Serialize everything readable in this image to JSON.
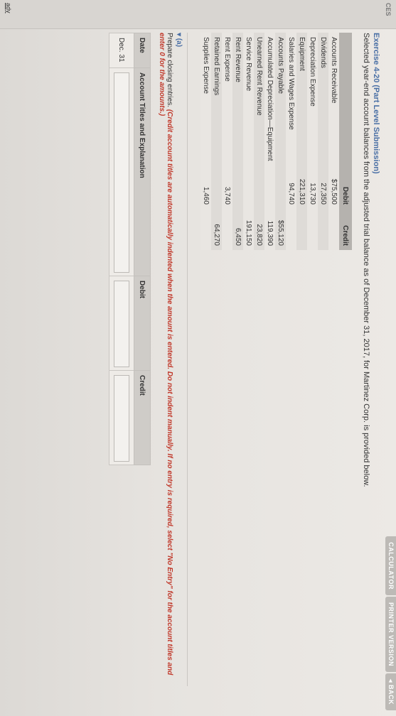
{
  "sidebar": {
    "label_top": "CES",
    "label_bottom": "ady"
  },
  "toolbar": {
    "calculator": "CALCULATOR",
    "printer_version": "PRINTER VERSION",
    "back": "◂ BACK"
  },
  "exercise": {
    "title": "Exercise 4-20 (Part Level Submission)",
    "intro": "Selected year-end account balances from the adjusted trial balance as of December 31, 2017, for Martinez Corp. is provided below."
  },
  "trial_balance": {
    "headers": {
      "debit": "Debit",
      "credit": "Credit"
    },
    "rows": [
      {
        "name": "Accounts Receivable",
        "debit": "$75,500",
        "credit": ""
      },
      {
        "name": "Dividends",
        "debit": "27,350",
        "credit": ""
      },
      {
        "name": "Depreciation Expense",
        "debit": "13,730",
        "credit": ""
      },
      {
        "name": "Equipment",
        "debit": "221,310",
        "credit": ""
      },
      {
        "name": "Salaries and Wages Expense",
        "debit": "94,740",
        "credit": ""
      },
      {
        "name": "Accounts Payable",
        "debit": "",
        "credit": "$55,120"
      },
      {
        "name": "Accumulated Depreciation—Equipment",
        "debit": "",
        "credit": "119,390"
      },
      {
        "name": "Unearned Rent Revenue",
        "debit": "",
        "credit": "23,820"
      },
      {
        "name": "Service Revenue",
        "debit": "",
        "credit": "191,150"
      },
      {
        "name": "Rent Revenue",
        "debit": "",
        "credit": "6,450"
      },
      {
        "name": "Rent Expense",
        "debit": "3,740",
        "credit": ""
      },
      {
        "name": "Retained Earnings",
        "debit": "",
        "credit": "64,270"
      },
      {
        "name": "Supplies Expense",
        "debit": "1,460",
        "credit": ""
      }
    ]
  },
  "part_a": {
    "label": "▾ (a)",
    "prepare_text": "Prepare closing entries.",
    "instruction": "(Credit account titles are automatically indented when the amount is entered. Do not indent manually. If no entry is required, select \"No Entry\" for the account titles and enter 0 for the amounts.)"
  },
  "journal": {
    "headers": {
      "date": "Date",
      "account": "Account Titles and Explanation",
      "debit": "Debit",
      "credit": "Credit"
    },
    "first_date": "Dec. 31"
  }
}
